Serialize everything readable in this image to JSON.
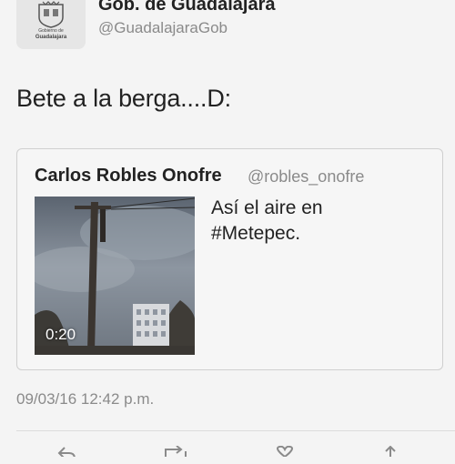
{
  "author": {
    "display_name": "Gob. de Guadalajara",
    "handle": "@GuadalajaraGob",
    "avatar_caption_top": "Gobierno de",
    "avatar_caption": "Guadalajara"
  },
  "tweet": {
    "text": "Bete a la berga....D:",
    "timestamp": "09/03/16 12:42 p.m."
  },
  "quoted_tweet": {
    "display_name": "Carlos Robles Onofre",
    "handle": "@robles_onofre",
    "text": "Así  el aire en\n#Metepec.",
    "media": {
      "type": "video",
      "duration": "0:20"
    }
  },
  "actions": [
    "reply-icon",
    "retweet-icon",
    "like-icon",
    "share-icon"
  ]
}
